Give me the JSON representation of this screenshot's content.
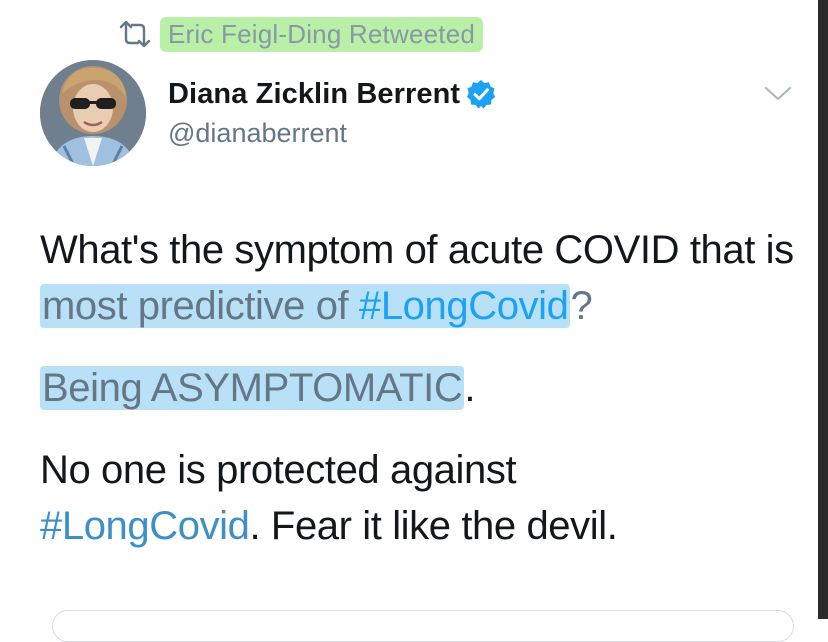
{
  "retweet_context": {
    "icon": "retweet-icon",
    "text": "Eric Feigl-Ding Retweeted",
    "highlight_color": "#b9efa6"
  },
  "author": {
    "display_name": "Diana Zicklin Berrent",
    "handle": "@dianaberrent",
    "verified_icon": "verified-badge-icon",
    "verified_color": "#1da1f2"
  },
  "menu": {
    "icon": "chevron-down-icon"
  },
  "tweet": {
    "line1_plain": "What's the symptom of acute COVID that is ",
    "line1_highlight_text": "most predictive of ",
    "line1_hashtag": "#LongCovid",
    "line1_end": "?",
    "line2_highlight": "Being ASYMPTOMATIC",
    "line2_end": ".",
    "line3_plain": "No one is protected against ",
    "line3_hashtag": "#LongCovid",
    "line3_end": ". Fear it like the devil."
  },
  "colors": {
    "text": "#14171a",
    "secondary": "#657786",
    "link": "#1da1f2",
    "highlight_blue": "#b8e1f8"
  }
}
